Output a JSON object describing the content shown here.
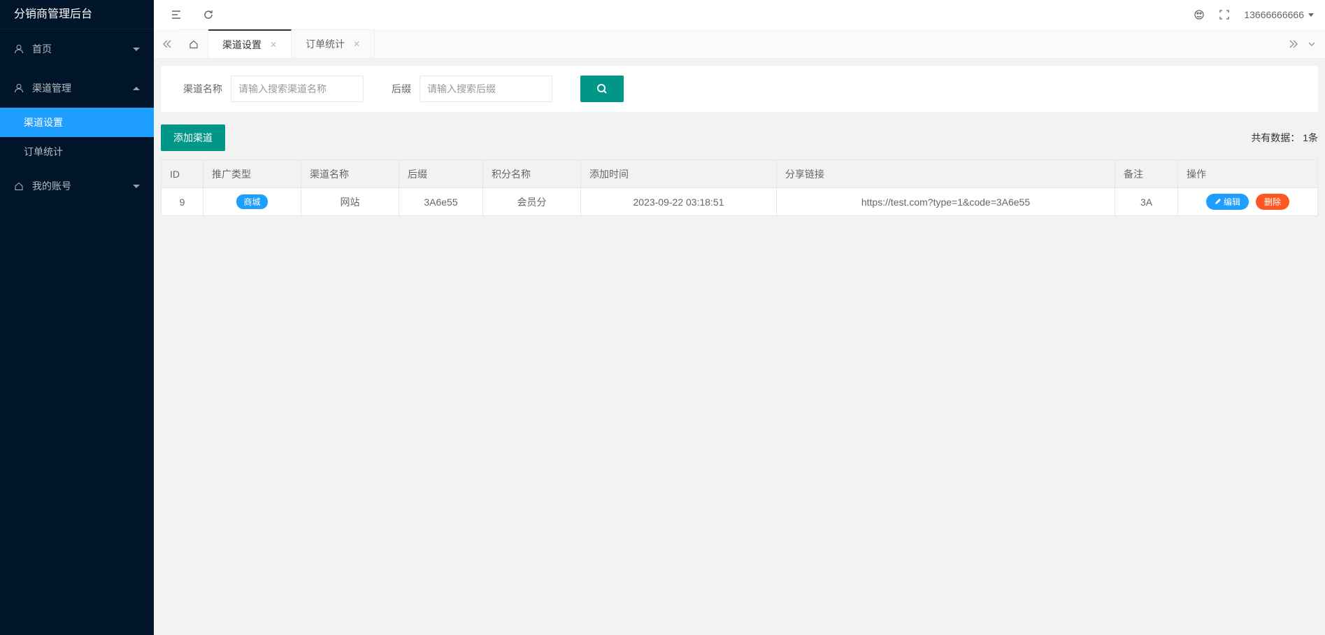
{
  "app_title": "分销商管理后台",
  "user_phone": "13666666666",
  "sidebar": {
    "home": "首页",
    "channel_mgmt": "渠道管理",
    "channel_settings": "渠道设置",
    "order_stats": "订单统计",
    "my_account": "我的账号"
  },
  "tabs": {
    "channel_settings": "渠道设置",
    "order_stats": "订单统计"
  },
  "search": {
    "label_channel_name": "渠道名称",
    "placeholder_channel_name": "请输入搜索渠道名称",
    "label_suffix": "后缀",
    "placeholder_suffix": "请输入搜索后缀"
  },
  "toolbar": {
    "add_channel": "添加渠道",
    "data_count_label": "共有数据：",
    "data_count_value": "1条"
  },
  "table": {
    "headers": {
      "id": "ID",
      "promo_type": "推广类型",
      "channel_name": "渠道名称",
      "suffix": "后缀",
      "points_name": "积分名称",
      "add_time": "添加时间",
      "share_link": "分享链接",
      "remark": "备注",
      "action": "操作"
    },
    "rows": [
      {
        "id": "9",
        "promo_type": "商城",
        "channel_name": "网站",
        "suffix": "3A6e55",
        "points_name": "会员分",
        "add_time": "2023-09-22 03:18:51",
        "share_link": "https://test.com?type=1&code=3A6e55",
        "remark": "3A"
      }
    ],
    "actions": {
      "edit": "编辑",
      "delete": "删除"
    }
  }
}
